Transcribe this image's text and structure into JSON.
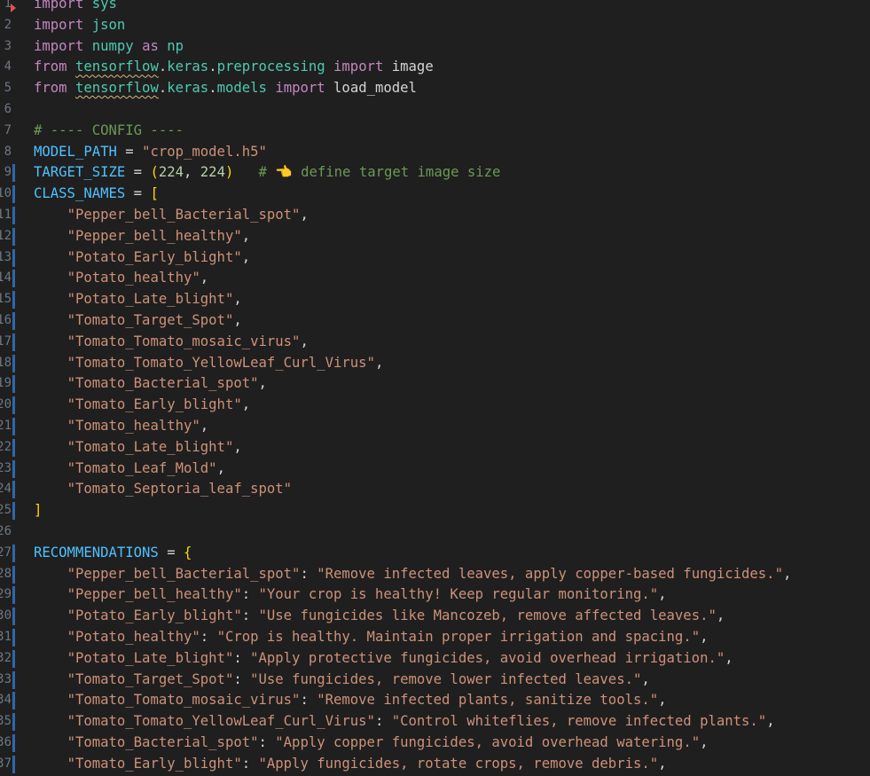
{
  "editor": {
    "lines": [
      {
        "n": "1",
        "tokens": [
          [
            "kw",
            "import"
          ],
          [
            "plain",
            " "
          ],
          [
            "mod",
            "sys"
          ]
        ]
      },
      {
        "n": "2",
        "tokens": [
          [
            "kw",
            "import"
          ],
          [
            "plain",
            " "
          ],
          [
            "mod",
            "json"
          ]
        ]
      },
      {
        "n": "3",
        "tokens": [
          [
            "kw",
            "import"
          ],
          [
            "plain",
            " "
          ],
          [
            "mod",
            "numpy"
          ],
          [
            "plain",
            " "
          ],
          [
            "kw",
            "as"
          ],
          [
            "plain",
            " "
          ],
          [
            "mod",
            "np"
          ]
        ]
      },
      {
        "n": "4",
        "tokens": [
          [
            "kw",
            "from"
          ],
          [
            "plain",
            " "
          ],
          [
            "modsq",
            "tensorflow"
          ],
          [
            "plain",
            "."
          ],
          [
            "mod",
            "keras"
          ],
          [
            "plain",
            "."
          ],
          [
            "mod",
            "preprocessing"
          ],
          [
            "plain",
            " "
          ],
          [
            "kw",
            "import"
          ],
          [
            "plain",
            " image"
          ]
        ]
      },
      {
        "n": "5",
        "tokens": [
          [
            "kw",
            "from"
          ],
          [
            "plain",
            " "
          ],
          [
            "modsq",
            "tensorflow"
          ],
          [
            "plain",
            "."
          ],
          [
            "mod",
            "keras"
          ],
          [
            "plain",
            "."
          ],
          [
            "mod",
            "models"
          ],
          [
            "plain",
            " "
          ],
          [
            "kw",
            "import"
          ],
          [
            "plain",
            " load_model"
          ]
        ]
      },
      {
        "n": "6",
        "tokens": []
      },
      {
        "n": "7",
        "tokens": [
          [
            "cmt",
            "# ---- CONFIG ----"
          ]
        ]
      },
      {
        "n": "8",
        "tokens": [
          [
            "const",
            "MODEL_PATH"
          ],
          [
            "plain",
            " = "
          ],
          [
            "str",
            "\"crop_model.h5\""
          ]
        ]
      },
      {
        "n": "9",
        "tokens": [
          [
            "const",
            "TARGET_SIZE"
          ],
          [
            "plain",
            " = "
          ],
          [
            "brk",
            "("
          ],
          [
            "num",
            "224"
          ],
          [
            "plain",
            ", "
          ],
          [
            "num",
            "224"
          ],
          [
            "brk",
            ")"
          ],
          [
            "plain",
            "   "
          ],
          [
            "cmt",
            "# 👈 define target image size"
          ]
        ]
      },
      {
        "n": "10",
        "tokens": [
          [
            "const",
            "CLASS_NAMES"
          ],
          [
            "plain",
            " = "
          ],
          [
            "brk",
            "["
          ]
        ]
      },
      {
        "n": "11",
        "tokens": [
          [
            "plain",
            "    "
          ],
          [
            "str",
            "\"Pepper_bell_Bacterial_spot\""
          ],
          [
            "plain",
            ","
          ]
        ]
      },
      {
        "n": "12",
        "tokens": [
          [
            "plain",
            "    "
          ],
          [
            "str",
            "\"Pepper_bell_healthy\""
          ],
          [
            "plain",
            ","
          ]
        ]
      },
      {
        "n": "13",
        "tokens": [
          [
            "plain",
            "    "
          ],
          [
            "str",
            "\"Potato_Early_blight\""
          ],
          [
            "plain",
            ","
          ]
        ]
      },
      {
        "n": "14",
        "tokens": [
          [
            "plain",
            "    "
          ],
          [
            "str",
            "\"Potato_healthy\""
          ],
          [
            "plain",
            ","
          ]
        ]
      },
      {
        "n": "15",
        "tokens": [
          [
            "plain",
            "    "
          ],
          [
            "str",
            "\"Potato_Late_blight\""
          ],
          [
            "plain",
            ","
          ]
        ]
      },
      {
        "n": "16",
        "tokens": [
          [
            "plain",
            "    "
          ],
          [
            "str",
            "\"Tomato_Target_Spot\""
          ],
          [
            "plain",
            ","
          ]
        ]
      },
      {
        "n": "17",
        "tokens": [
          [
            "plain",
            "    "
          ],
          [
            "str",
            "\"Tomato_Tomato_mosaic_virus\""
          ],
          [
            "plain",
            ","
          ]
        ]
      },
      {
        "n": "18",
        "tokens": [
          [
            "plain",
            "    "
          ],
          [
            "str",
            "\"Tomato_Tomato_YellowLeaf_Curl_Virus\""
          ],
          [
            "plain",
            ","
          ]
        ]
      },
      {
        "n": "19",
        "tokens": [
          [
            "plain",
            "    "
          ],
          [
            "str",
            "\"Tomato_Bacterial_spot\""
          ],
          [
            "plain",
            ","
          ]
        ]
      },
      {
        "n": "20",
        "tokens": [
          [
            "plain",
            "    "
          ],
          [
            "str",
            "\"Tomato_Early_blight\""
          ],
          [
            "plain",
            ","
          ]
        ]
      },
      {
        "n": "21",
        "tokens": [
          [
            "plain",
            "    "
          ],
          [
            "str",
            "\"Tomato_healthy\""
          ],
          [
            "plain",
            ","
          ]
        ]
      },
      {
        "n": "22",
        "tokens": [
          [
            "plain",
            "    "
          ],
          [
            "str",
            "\"Tomato_Late_blight\""
          ],
          [
            "plain",
            ","
          ]
        ]
      },
      {
        "n": "23",
        "tokens": [
          [
            "plain",
            "    "
          ],
          [
            "str",
            "\"Tomato_Leaf_Mold\""
          ],
          [
            "plain",
            ","
          ]
        ]
      },
      {
        "n": "24",
        "tokens": [
          [
            "plain",
            "    "
          ],
          [
            "str",
            "\"Tomato_Septoria_leaf_spot\""
          ]
        ]
      },
      {
        "n": "25",
        "tokens": [
          [
            "brk",
            "]"
          ]
        ]
      },
      {
        "n": "26",
        "tokens": []
      },
      {
        "n": "27",
        "tokens": [
          [
            "const",
            "RECOMMENDATIONS"
          ],
          [
            "plain",
            " = "
          ],
          [
            "brk",
            "{"
          ]
        ]
      },
      {
        "n": "28",
        "tokens": [
          [
            "plain",
            "    "
          ],
          [
            "str",
            "\"Pepper_bell_Bacterial_spot\""
          ],
          [
            "plain",
            ": "
          ],
          [
            "str",
            "\"Remove infected leaves, apply copper-based fungicides.\""
          ],
          [
            "plain",
            ","
          ]
        ]
      },
      {
        "n": "29",
        "tokens": [
          [
            "plain",
            "    "
          ],
          [
            "str",
            "\"Pepper_bell_healthy\""
          ],
          [
            "plain",
            ": "
          ],
          [
            "str",
            "\"Your crop is healthy! Keep regular monitoring.\""
          ],
          [
            "plain",
            ","
          ]
        ]
      },
      {
        "n": "30",
        "tokens": [
          [
            "plain",
            "    "
          ],
          [
            "str",
            "\"Potato_Early_blight\""
          ],
          [
            "plain",
            ": "
          ],
          [
            "str",
            "\"Use fungicides like Mancozeb, remove affected leaves.\""
          ],
          [
            "plain",
            ","
          ]
        ]
      },
      {
        "n": "31",
        "tokens": [
          [
            "plain",
            "    "
          ],
          [
            "str",
            "\"Potato_healthy\""
          ],
          [
            "plain",
            ": "
          ],
          [
            "str",
            "\"Crop is healthy. Maintain proper irrigation and spacing.\""
          ],
          [
            "plain",
            ","
          ]
        ]
      },
      {
        "n": "32",
        "tokens": [
          [
            "plain",
            "    "
          ],
          [
            "str",
            "\"Potato_Late_blight\""
          ],
          [
            "plain",
            ": "
          ],
          [
            "str",
            "\"Apply protective fungicides, avoid overhead irrigation.\""
          ],
          [
            "plain",
            ","
          ]
        ]
      },
      {
        "n": "33",
        "tokens": [
          [
            "plain",
            "    "
          ],
          [
            "str",
            "\"Tomato_Target_Spot\""
          ],
          [
            "plain",
            ": "
          ],
          [
            "str",
            "\"Use fungicides, remove lower infected leaves.\""
          ],
          [
            "plain",
            ","
          ]
        ]
      },
      {
        "n": "34",
        "tokens": [
          [
            "plain",
            "    "
          ],
          [
            "str",
            "\"Tomato_Tomato_mosaic_virus\""
          ],
          [
            "plain",
            ": "
          ],
          [
            "str",
            "\"Remove infected plants, sanitize tools.\""
          ],
          [
            "plain",
            ","
          ]
        ]
      },
      {
        "n": "35",
        "tokens": [
          [
            "plain",
            "    "
          ],
          [
            "str",
            "\"Tomato_Tomato_YellowLeaf_Curl_Virus\""
          ],
          [
            "plain",
            ": "
          ],
          [
            "str",
            "\"Control whiteflies, remove infected plants.\""
          ],
          [
            "plain",
            ","
          ]
        ]
      },
      {
        "n": "36",
        "tokens": [
          [
            "plain",
            "    "
          ],
          [
            "str",
            "\"Tomato_Bacterial_spot\""
          ],
          [
            "plain",
            ": "
          ],
          [
            "str",
            "\"Apply copper fungicides, avoid overhead watering.\""
          ],
          [
            "plain",
            ","
          ]
        ]
      },
      {
        "n": "37",
        "tokens": [
          [
            "plain",
            "    "
          ],
          [
            "str",
            "\"Tomato_Early_blight\""
          ],
          [
            "plain",
            ": "
          ],
          [
            "str",
            "\"Apply fungicides, rotate crops, remove debris.\""
          ],
          [
            "plain",
            ","
          ]
        ]
      }
    ]
  }
}
